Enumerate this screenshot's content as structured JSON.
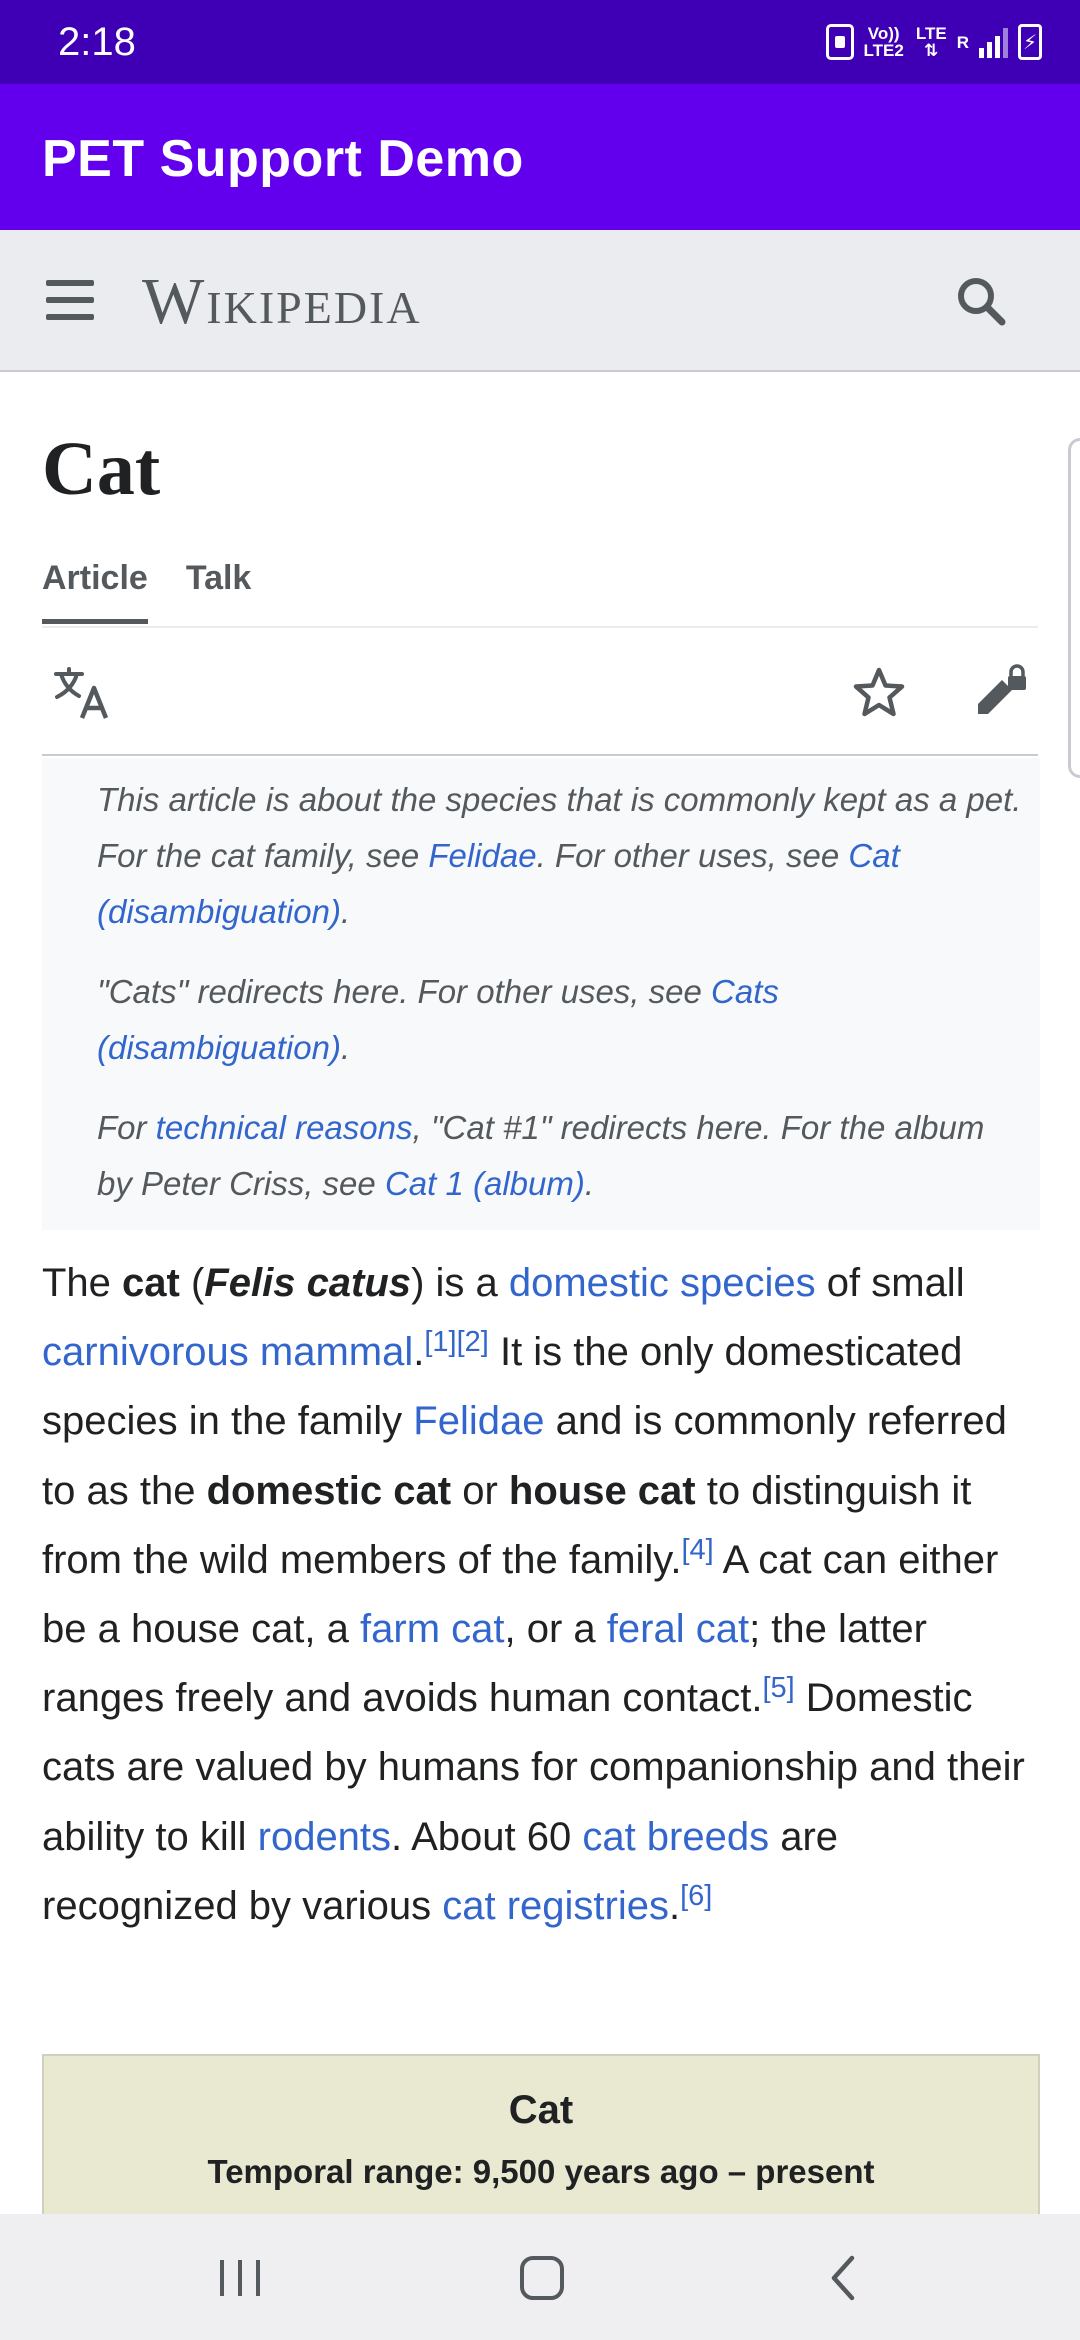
{
  "status_bar": {
    "time": "2:18",
    "net_line1": "Vo))",
    "net_line2": "LTE2",
    "lte_label": "LTE",
    "roaming_label": "R"
  },
  "app_bar": {
    "title": "PET Support Demo"
  },
  "wiki_header": {
    "wordmark": "Wikipedia"
  },
  "page": {
    "title": "Cat",
    "tabs": [
      {
        "label": "Article",
        "active": true
      },
      {
        "label": "Talk",
        "active": false
      }
    ]
  },
  "hatnotes": {
    "h1": {
      "t1": "This article is about the species that is commonly kept as a pet. For the cat family, see ",
      "l1": "Felidae",
      "t2": ". For other uses, see ",
      "l2": "Cat (disambiguation)",
      "t3": "."
    },
    "h2": {
      "t1": "\"Cats\" redirects here. For other uses, see ",
      "l1": "Cats (disambiguation)",
      "t2": "."
    },
    "h3": {
      "t0": "For ",
      "l1": "technical reasons",
      "t1": ", \"Cat #1\" redirects here. For the album by Peter Criss, see ",
      "l2": "Cat 1 (album)",
      "t2": "."
    }
  },
  "intro": {
    "s1": "The ",
    "b1": "cat",
    "s2": " (",
    "bi1": "Felis catus",
    "s3": ") is a ",
    "l1": "domestic species",
    "s4": " of small ",
    "l2": "carnivorous mammal",
    "s5": ".",
    "r1": "[1]",
    "r2": "[2]",
    "s6": " It is the only domesticated species in the family ",
    "l3": "Felidae",
    "s7": " and is commonly referred to as the ",
    "b2": "domestic cat",
    "s8": " or ",
    "b3": "house cat",
    "s9": " to distinguish it from the wild members of the family.",
    "r4": "[4]",
    "s10": " A cat can either be a house cat, a ",
    "l4": "farm cat",
    "s11": ", or a ",
    "l5": "feral cat",
    "s12": "; the latter ranges freely and avoids human contact.",
    "r5": "[5]",
    "s13": " Domestic cats are valued by humans for companionship and their ability to kill ",
    "l6": "rodents",
    "s14": ". About 60 ",
    "l7": "cat breeds",
    "s15": " are recognized by various ",
    "l8": "cat registries",
    "s16": ".",
    "r6": "[6]"
  },
  "infobox": {
    "title": "Cat",
    "temporal_range": "Temporal range: 9,500 years ago – present"
  },
  "colors": {
    "status_bar": "#3f00b5",
    "app_bar": "#6200ee",
    "link": "#3366cc",
    "infobox": "#e9e9d1"
  },
  "icons": [
    "menu-icon",
    "search-icon",
    "translate-icon",
    "star-icon",
    "edit-lock-icon",
    "recent-apps-icon",
    "home-icon",
    "back-icon"
  ]
}
